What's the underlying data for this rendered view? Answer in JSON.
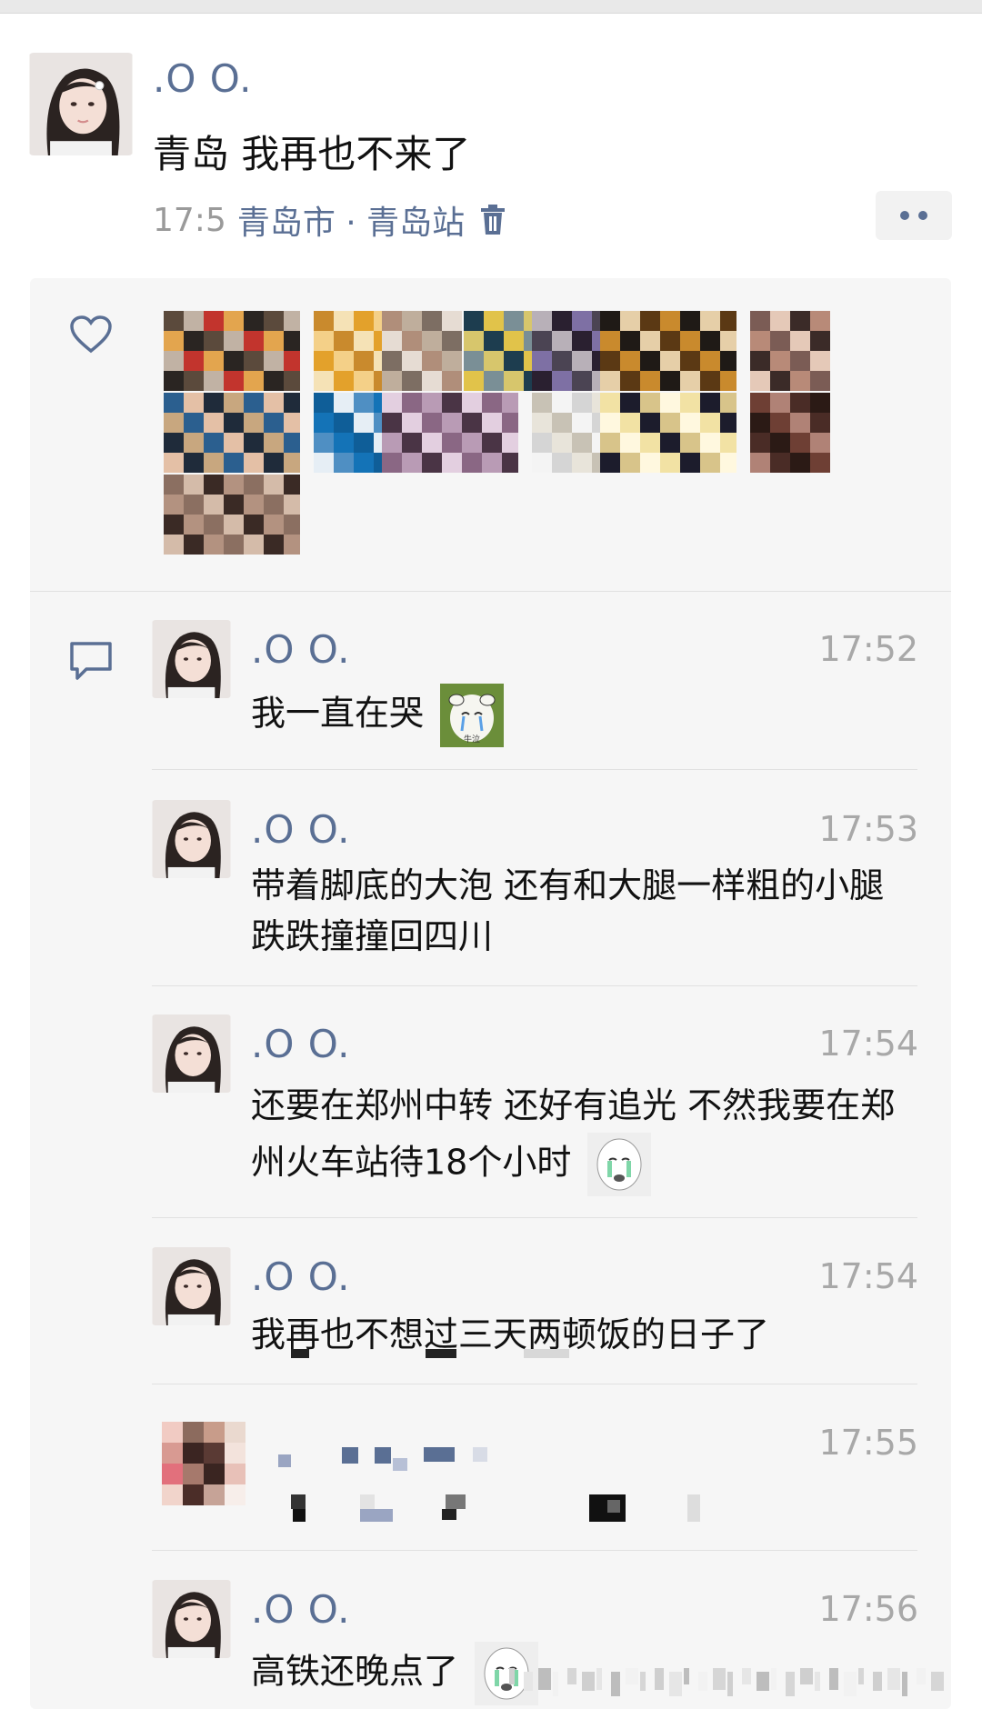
{
  "post": {
    "author": ".O O.",
    "text": "青岛 我再也不来了",
    "time": "17:5",
    "location": "青岛市 · 青岛站"
  },
  "icons": {
    "like": "heart-icon",
    "comment": "comment-icon",
    "delete": "trash-icon",
    "more": "more-dots-icon"
  },
  "colors": {
    "name": "#5a6f94",
    "box_bg": "#f6f6f6",
    "time": "#a8a8a8"
  },
  "comments": [
    {
      "author": ".O O.",
      "time": "17:52",
      "text": "我一直在哭"
    },
    {
      "author": ".O O.",
      "time": "17:53",
      "text": "带着脚底的大泡 还有和大腿一样粗的小腿 跌跌撞撞回四川"
    },
    {
      "author": ".O O.",
      "time": "17:54",
      "text": "还要在郑州中转 还好有追光 不然我要在郑州火车站待18个小时"
    },
    {
      "author": ".O O.",
      "time": "17:54",
      "text": "我再也不想过三天两顿饭的日子了"
    },
    {
      "author": "",
      "time": "17:55",
      "text": ""
    },
    {
      "author": ".O O.",
      "time": "17:56",
      "text": "高铁还晚点了"
    }
  ],
  "emoji_labels": {
    "cow": "牛泣"
  }
}
